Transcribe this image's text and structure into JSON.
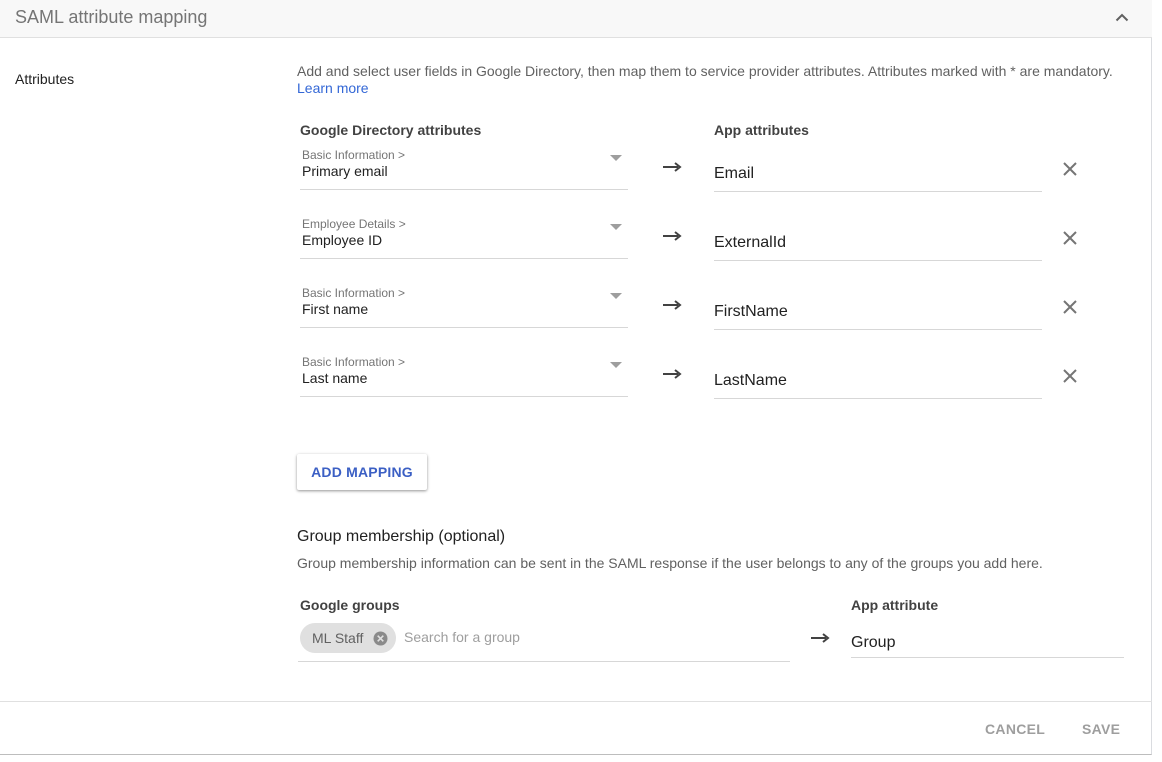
{
  "header": {
    "title": "SAML attribute mapping",
    "collapse_icon": "chevron-up-icon"
  },
  "section_label": "Attributes",
  "description": {
    "text": "Add and select user fields in Google Directory, then map them to service provider attributes. Attributes marked with * are mandatory.",
    "link": "Learn more",
    "link_color": "#3367d6"
  },
  "columns": {
    "directory": "Google Directory attributes",
    "app": "App attributes"
  },
  "mappings": [
    {
      "category": "Basic Information >",
      "field": "Primary email",
      "app_attribute": "Email"
    },
    {
      "category": "Employee Details >",
      "field": "Employee ID",
      "app_attribute": "ExternalId"
    },
    {
      "category": "Basic Information >",
      "field": "First name",
      "app_attribute": "FirstName"
    },
    {
      "category": "Basic Information >",
      "field": "Last name",
      "app_attribute": "LastName"
    }
  ],
  "add_mapping_label": "ADD MAPPING",
  "group_membership": {
    "title": "Group membership (optional)",
    "description": "Group membership information can be sent in the SAML response if the user belongs to any of the groups you add here.",
    "groups_header": "Google groups",
    "app_attribute_header": "App attribute",
    "chips": [
      "ML Staff"
    ],
    "search_placeholder": "Search for a group",
    "app_attribute_value": "Group"
  },
  "footer": {
    "cancel_label": "CANCEL",
    "save_label": "SAVE"
  },
  "colors": {
    "accent": "#3b5fc4",
    "disabled": "#9e9e9e",
    "header_bg": "#f8f8f8"
  }
}
